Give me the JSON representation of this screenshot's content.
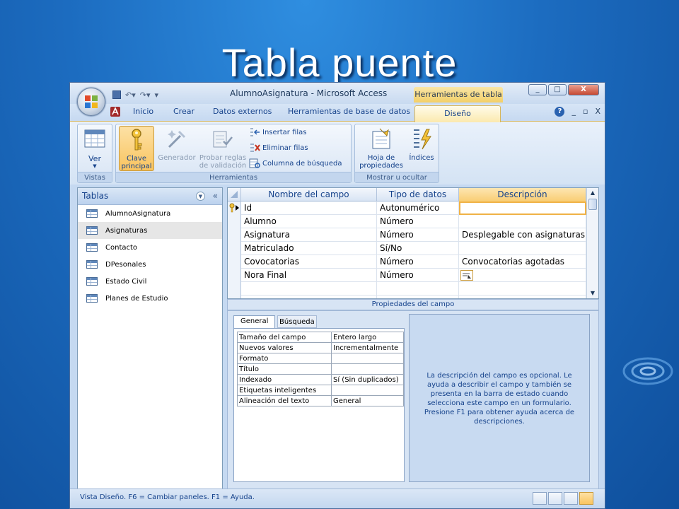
{
  "slide": {
    "title": "Tabla puente"
  },
  "window": {
    "title": "AlumnoAsignatura - Microsoft Access",
    "context_tab": "Herramientas de tabla",
    "controls": {
      "minimize": "_",
      "maximize": "□",
      "close": "X"
    }
  },
  "ribbon_tabs": [
    "Inicio",
    "Crear",
    "Datos externos",
    "Herramientas de base de datos",
    "Diseño"
  ],
  "ribbon_right": {
    "minimize": "_",
    "restore": "▫",
    "close": "X"
  },
  "ribbon": {
    "vistas": {
      "label": "Vistas",
      "ver": "Ver"
    },
    "herramientas": {
      "label": "Herramientas",
      "clave_line1": "Clave",
      "clave_line2": "principal",
      "generador": "Generador",
      "probar_line1": "Probar reglas",
      "probar_line2": "de validación",
      "insertar": "Insertar filas",
      "eliminar": "Eliminar filas",
      "columna": "Columna de búsqueda"
    },
    "mostrar": {
      "label": "Mostrar u ocultar",
      "hoja_line1": "Hoja de",
      "hoja_line2": "propiedades",
      "indices": "Índices"
    }
  },
  "nav": {
    "header": "Tablas",
    "items": [
      "AlumnoAsignatura",
      "Asignaturas",
      "Contacto",
      "DPesonales",
      "Estado Civil",
      "Planes de Estudio"
    ],
    "selected_index": 1
  },
  "grid": {
    "headers": [
      "Nombre del campo",
      "Tipo de datos",
      "Descripción"
    ],
    "rows": [
      {
        "name": "Id",
        "type": "Autonumérico",
        "desc": ""
      },
      {
        "name": "Alumno",
        "type": "Número",
        "desc": ""
      },
      {
        "name": "Asignatura",
        "type": "Número",
        "desc": "Desplegable con asignaturas"
      },
      {
        "name": "Matriculado",
        "type": "Sí/No",
        "desc": ""
      },
      {
        "name": "Covocatorias",
        "type": "Número",
        "desc": "Convocatorias agotadas"
      },
      {
        "name": "Nora Final",
        "type": "Número",
        "desc": ""
      }
    ]
  },
  "props": {
    "header": "Propiedades del campo",
    "tabs": [
      "General",
      "Búsqueda"
    ],
    "rows": [
      {
        "label": "Tamaño del campo",
        "value": "Entero largo"
      },
      {
        "label": "Nuevos valores",
        "value": "Incrementalmente"
      },
      {
        "label": "Formato",
        "value": ""
      },
      {
        "label": "Título",
        "value": ""
      },
      {
        "label": "Indexado",
        "value": "Sí (Sin duplicados)"
      },
      {
        "label": "Etiquetas inteligentes",
        "value": ""
      },
      {
        "label": "Alineación del texto",
        "value": "General"
      }
    ],
    "description": "La descripción del campo es opcional. Le ayuda a describir el campo y también se presenta en la barra de estado cuando selecciona este campo en un formulario. Presione F1 para obtener ayuda acerca de descripciones."
  },
  "status": {
    "text": "Vista Diseño.  F6 = Cambiar paneles.  F1 = Ayuda."
  },
  "colors": {
    "accent": "#15428b",
    "active_tab": "#fbe9ae",
    "slide_bg": "#1c6cc0"
  }
}
